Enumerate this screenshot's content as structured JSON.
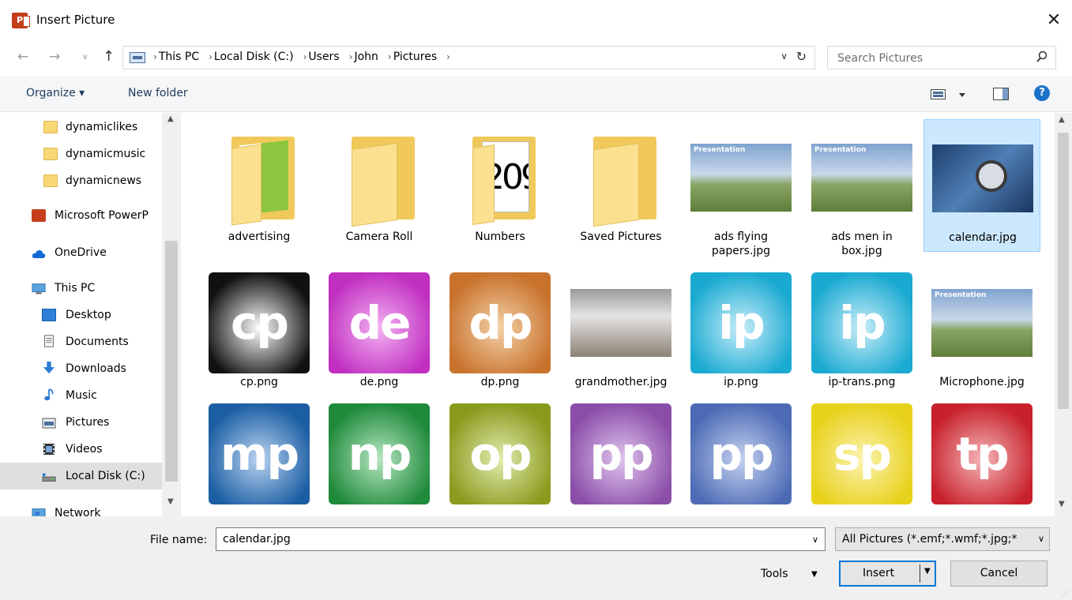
{
  "window": {
    "title": "Insert Picture",
    "app_icon_text": "P",
    "close_glyph": "✕"
  },
  "address": {
    "crumbs": [
      "This PC",
      "Local Disk (C:)",
      "Users",
      "John",
      "Pictures"
    ],
    "search_placeholder": "Search Pictures"
  },
  "toolbar": {
    "organize_label": "Organize ▾",
    "new_folder_label": "New folder",
    "help_label": "?"
  },
  "nav": {
    "items": [
      {
        "label": "dynamiclikes",
        "icon": "folder-icon"
      },
      {
        "label": "dynamicmusic",
        "icon": "folder-icon"
      },
      {
        "label": "dynamicnews",
        "icon": "folder-icon"
      },
      {
        "label": "Microsoft PowerP",
        "icon": "powerpoint-icon"
      },
      {
        "label": "OneDrive",
        "icon": "cloud-icon"
      },
      {
        "label": "This PC",
        "icon": "computer-icon"
      },
      {
        "label": "Desktop",
        "icon": "desktop-icon"
      },
      {
        "label": "Documents",
        "icon": "documents-icon"
      },
      {
        "label": "Downloads",
        "icon": "download-icon"
      },
      {
        "label": "Music",
        "icon": "music-icon"
      },
      {
        "label": "Pictures",
        "icon": "pictures-icon"
      },
      {
        "label": "Videos",
        "icon": "videos-icon"
      },
      {
        "label": "Local Disk (C:)",
        "icon": "drive-icon"
      },
      {
        "label": "Network",
        "icon": "network-icon"
      }
    ]
  },
  "files": [
    {
      "name": "advertising",
      "kind": "folder"
    },
    {
      "name": "Camera Roll",
      "kind": "folder"
    },
    {
      "name": "Numbers",
      "kind": "folder",
      "overlay": "209"
    },
    {
      "name": "Saved Pictures",
      "kind": "folder"
    },
    {
      "name": "ads flying papers.jpg",
      "kind": "photo",
      "caption": "Presentation"
    },
    {
      "name": "ads men in box.jpg",
      "kind": "photo",
      "caption": "Presentation"
    },
    {
      "name": "calendar.jpg",
      "kind": "photo"
    },
    {
      "name": "cp.png",
      "kind": "app",
      "text": "cp",
      "color": "#111111"
    },
    {
      "name": "de.png",
      "kind": "app",
      "text": "de",
      "color": "#c02fc0"
    },
    {
      "name": "dp.png",
      "kind": "app",
      "text": "dp",
      "color": "#c8722c"
    },
    {
      "name": "grandmother.jpg",
      "kind": "photo"
    },
    {
      "name": "ip.png",
      "kind": "app",
      "text": "ip",
      "color": "#19a9d1"
    },
    {
      "name": "ip-trans.png",
      "kind": "app",
      "text": "ip",
      "color": "#19a9d1"
    },
    {
      "name": "Microphone.jpg",
      "kind": "photo",
      "caption": "Presentation"
    },
    {
      "name": "",
      "kind": "app",
      "text": "mp",
      "color": "#1b5ea3"
    },
    {
      "name": "",
      "kind": "app",
      "text": "np",
      "color": "#1e8a3a"
    },
    {
      "name": "",
      "kind": "app",
      "text": "op",
      "color": "#8a9a1c"
    },
    {
      "name": "",
      "kind": "app",
      "text": "pp",
      "color": "#8a4ea8"
    },
    {
      "name": "",
      "kind": "app",
      "text": "pp",
      "color": "#4d6bb5"
    },
    {
      "name": "",
      "kind": "app",
      "text": "sp",
      "color": "#e8d11a"
    },
    {
      "name": "",
      "kind": "app",
      "text": "tp",
      "color": "#c8212b"
    }
  ],
  "bottom": {
    "file_name_label": "File name:",
    "file_name_value": "calendar.jpg",
    "filter_value": "All Pictures (*.emf;*.wmf;*.jpg;*",
    "tools_label": "Tools",
    "insert_label": "Insert",
    "cancel_label": "Cancel"
  }
}
